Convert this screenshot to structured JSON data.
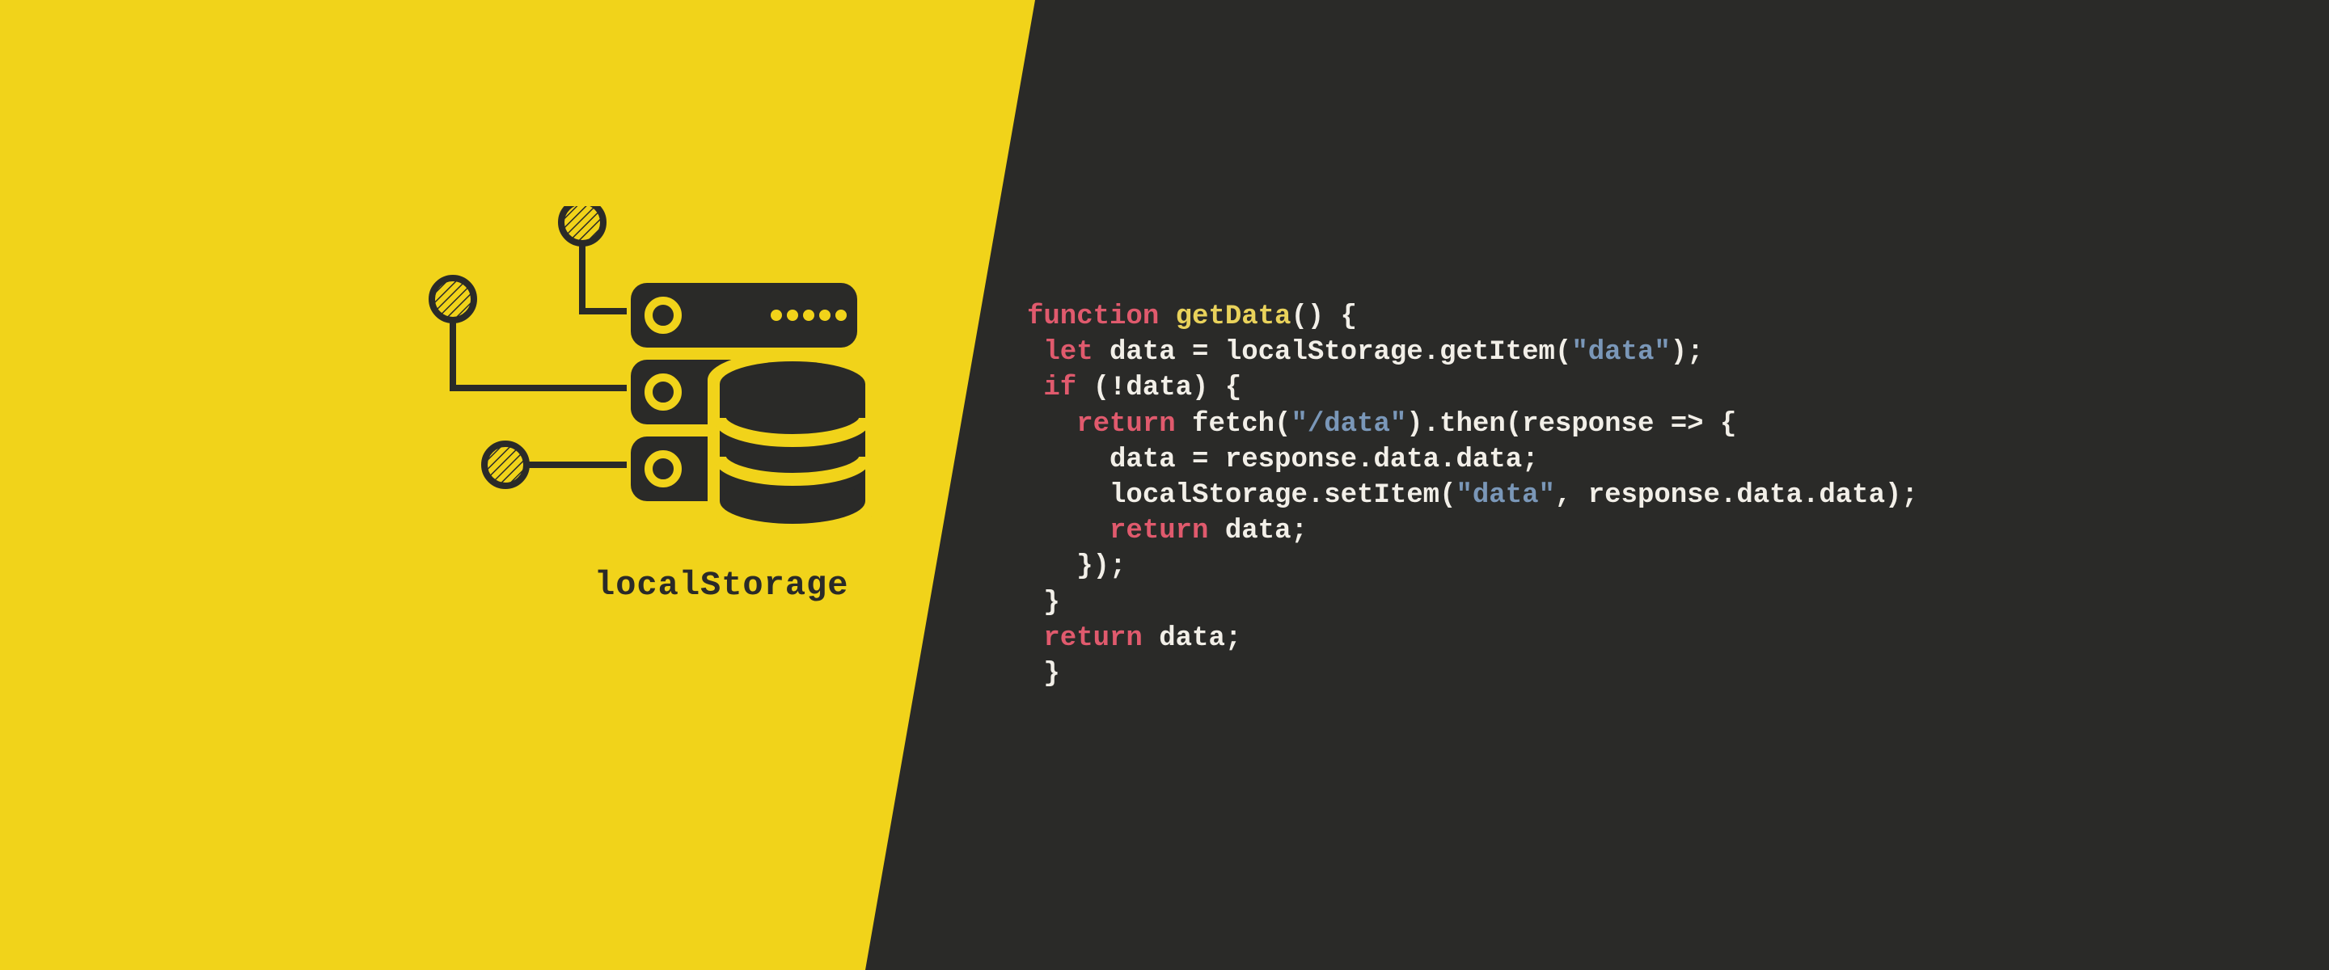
{
  "colors": {
    "yellow": "#f1d31a",
    "dark": "#2a2a28",
    "code_text": "#f2efe8",
    "code_keyword": "#e05a6d",
    "code_funcname": "#e9d25b",
    "code_string": "#7a97b8"
  },
  "illustration": {
    "caption": "localStorage"
  },
  "code": {
    "tokens": [
      [
        [
          "kw",
          "function"
        ],
        [
          "plain",
          " "
        ],
        [
          "fn",
          "getData"
        ],
        [
          "plain",
          "() {"
        ]
      ],
      [
        [
          "plain",
          " "
        ],
        [
          "kw",
          "let"
        ],
        [
          "plain",
          " data = localStorage.getItem("
        ],
        [
          "str",
          "\"data\""
        ],
        [
          "plain",
          ");"
        ]
      ],
      [
        [
          "plain",
          " "
        ],
        [
          "kw",
          "if"
        ],
        [
          "plain",
          " (!data) {"
        ]
      ],
      [
        [
          "plain",
          "   "
        ],
        [
          "kw",
          "return"
        ],
        [
          "plain",
          " fetch("
        ],
        [
          "str",
          "\"/data\""
        ],
        [
          "plain",
          ").then(response => {"
        ]
      ],
      [
        [
          "plain",
          "     data = response.data.data;"
        ]
      ],
      [
        [
          "plain",
          "     localStorage.setItem("
        ],
        [
          "str",
          "\"data\""
        ],
        [
          "plain",
          ", response.data.data);"
        ]
      ],
      [
        [
          "plain",
          "     "
        ],
        [
          "kw",
          "return"
        ],
        [
          "plain",
          " data;"
        ]
      ],
      [
        [
          "plain",
          "   });"
        ]
      ],
      [
        [
          "plain",
          " }"
        ]
      ],
      [
        [
          "plain",
          " "
        ],
        [
          "kw",
          "return"
        ],
        [
          "plain",
          " data;"
        ]
      ],
      [
        [
          "plain",
          " }"
        ]
      ]
    ]
  }
}
